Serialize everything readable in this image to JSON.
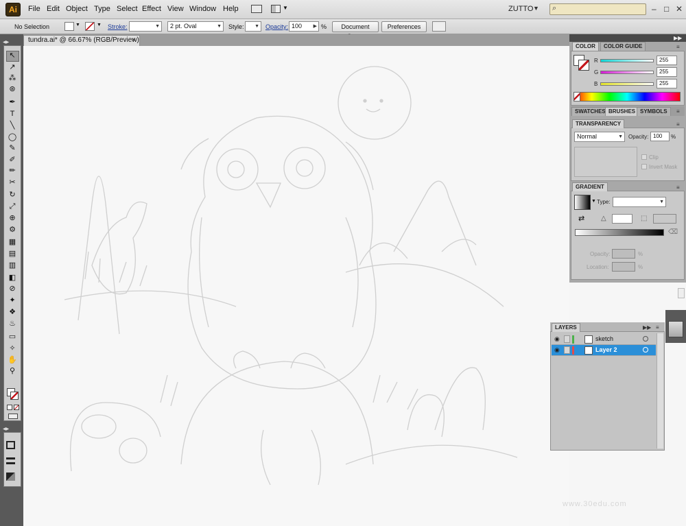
{
  "app": {
    "logo_text": "Ai",
    "menu": [
      "File",
      "Edit",
      "Object",
      "Type",
      "Select",
      "Effect",
      "View",
      "Window",
      "Help"
    ],
    "workspace": "ZUTTO",
    "workspace_caret": "▼",
    "search_icon": "⌕",
    "window_controls": [
      "–",
      "□",
      "✕"
    ]
  },
  "control_bar": {
    "selection": "No Selection",
    "stroke_label": "Stroke:",
    "brush_value": "2 pt. Oval",
    "style_label": "Style:",
    "opacity_label": "Opacity:",
    "opacity_value": "100",
    "opacity_unit": "%",
    "document_setup": "Document Setup",
    "preferences": "Preferences"
  },
  "document": {
    "tab_title": "tundra.ai* @ 66.67% (RGB/Preview)",
    "close": "×"
  },
  "tools": {
    "icons": [
      "↖",
      "↗",
      "⁂",
      "⊛",
      "✒",
      "T",
      "╲",
      "◯",
      "✎",
      "✐",
      "✏",
      "✂",
      "↻",
      "⤢",
      "⊕",
      "⚙",
      "▦",
      "▤",
      "▥",
      "◧",
      "⊘",
      "✦",
      "❖",
      "♨",
      "▭",
      "✧",
      "✋",
      "⚲"
    ]
  },
  "color_panel": {
    "tabs": [
      "COLOR",
      "COLOR GUIDE"
    ],
    "r_label": "R",
    "g_label": "G",
    "b_label": "B",
    "r": "255",
    "g": "255",
    "b": "255",
    "color": "#ffffff"
  },
  "brushes_tabs": [
    "SWATCHES",
    "BRUSHES",
    "SYMBOLS"
  ],
  "transparency_panel": {
    "title": "TRANSPARENCY",
    "blend_mode": "Normal",
    "opacity_label": "Opacity:",
    "opacity_value": "100",
    "opacity_unit": "%",
    "clip": "Clip",
    "invert_mask": "Invert Mask"
  },
  "gradient_panel": {
    "title": "GRADIENT",
    "type_label": "Type:",
    "type_value": "",
    "opacity_label": "Opacity:",
    "location_label": "Location:",
    "unit": "%"
  },
  "layers_panel": {
    "title": "LAYERS",
    "layers": [
      {
        "name": "sketch",
        "color": "#4bb24b",
        "selected": false
      },
      {
        "name": "Layer 2",
        "color": "#e34b4b",
        "selected": true
      }
    ]
  },
  "watermark": "www.30edu.com"
}
